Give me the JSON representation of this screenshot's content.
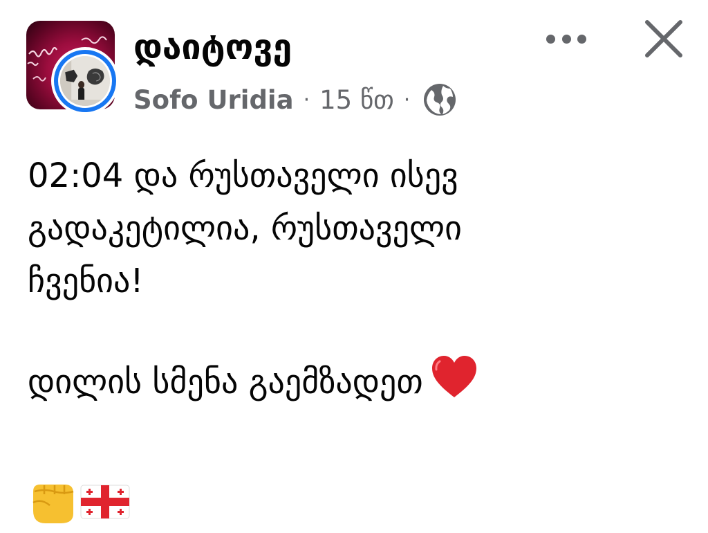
{
  "post": {
    "group_name": "დაიტოვე",
    "author": "Sofo Uridia",
    "separator": "·",
    "time": "15 წთ",
    "privacy_icon": "globe-icon"
  },
  "content": {
    "lines": [
      "02:04 და რუსთაველი ისევ",
      "გადაკეტილია, რუსთაველი",
      "ჩვენია!"
    ],
    "line2": "დილის სმენა გაემზადეთ",
    "heart_icon": "red-heart-emoji",
    "trailing_emojis": [
      "raised-fist-emoji",
      "georgia-flag-emoji"
    ]
  },
  "colors": {
    "accent_ring": "#1877f2",
    "meta_gray": "#65676b",
    "text": "#050505",
    "heart": "#e0242e",
    "fist": "#f6c030"
  }
}
